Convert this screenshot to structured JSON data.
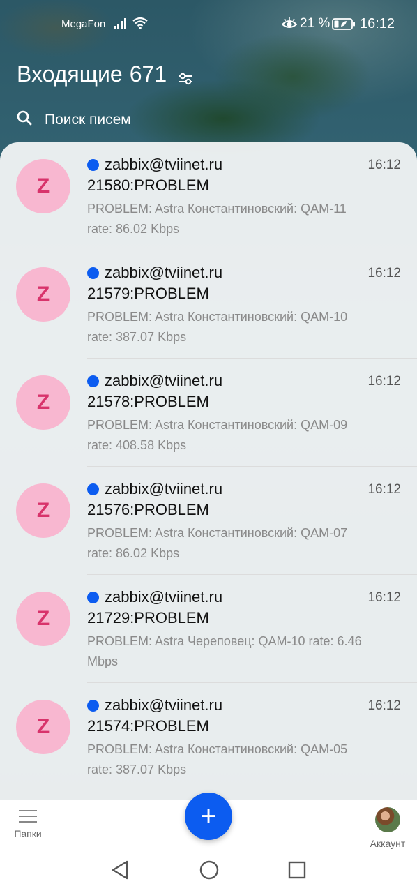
{
  "status_bar": {
    "carrier": "MegaFon",
    "battery_percent": "21 %",
    "time": "16:12",
    "icons": [
      "signal-icon",
      "wifi-icon",
      "eye-comfort-icon",
      "battery-icon"
    ]
  },
  "header": {
    "title": "Входящие",
    "count": "671",
    "filter_icon": "filter-icon"
  },
  "search": {
    "placeholder": "Поиск писем",
    "icon": "search-icon"
  },
  "messages": [
    {
      "avatar_letter": "Z",
      "sender": "zabbix@tviinet.ru",
      "time": "16:12",
      "subject": "21580:PROBLEM",
      "preview": "PROBLEM: Astra Константиновский: QAM-11 rate: 86.02 Kbps",
      "unread": true
    },
    {
      "avatar_letter": "Z",
      "sender": "zabbix@tviinet.ru",
      "time": "16:12",
      "subject": "21579:PROBLEM",
      "preview": "PROBLEM: Astra Константиновский: QAM-10 rate: 387.07 Kbps",
      "unread": true
    },
    {
      "avatar_letter": "Z",
      "sender": "zabbix@tviinet.ru",
      "time": "16:12",
      "subject": "21578:PROBLEM",
      "preview": "PROBLEM: Astra Константиновский: QAM-09 rate: 408.58 Kbps",
      "unread": true
    },
    {
      "avatar_letter": "Z",
      "sender": "zabbix@tviinet.ru",
      "time": "16:12",
      "subject": "21576:PROBLEM",
      "preview": "PROBLEM: Astra Константиновский: QAM-07 rate: 86.02 Kbps",
      "unread": true
    },
    {
      "avatar_letter": "Z",
      "sender": "zabbix@tviinet.ru",
      "time": "16:12",
      "subject": "21729:PROBLEM",
      "preview": "PROBLEM: Astra Череповец: QAM-10 rate: 6.46 Mbps",
      "unread": true
    },
    {
      "avatar_letter": "Z",
      "sender": "zabbix@tviinet.ru",
      "time": "16:12",
      "subject": "21574:PROBLEM",
      "preview": "PROBLEM: Astra Константиновский: QAM-05 rate: 387.07 Kbps",
      "unread": true
    }
  ],
  "bottom_nav": {
    "folders_label": "Папки",
    "compose_symbol": "+",
    "account_label": "Аккаунт"
  },
  "colors": {
    "accent": "#0c5cf0",
    "avatar_bg": "#f8b7d0",
    "avatar_letter": "#d8336b"
  }
}
